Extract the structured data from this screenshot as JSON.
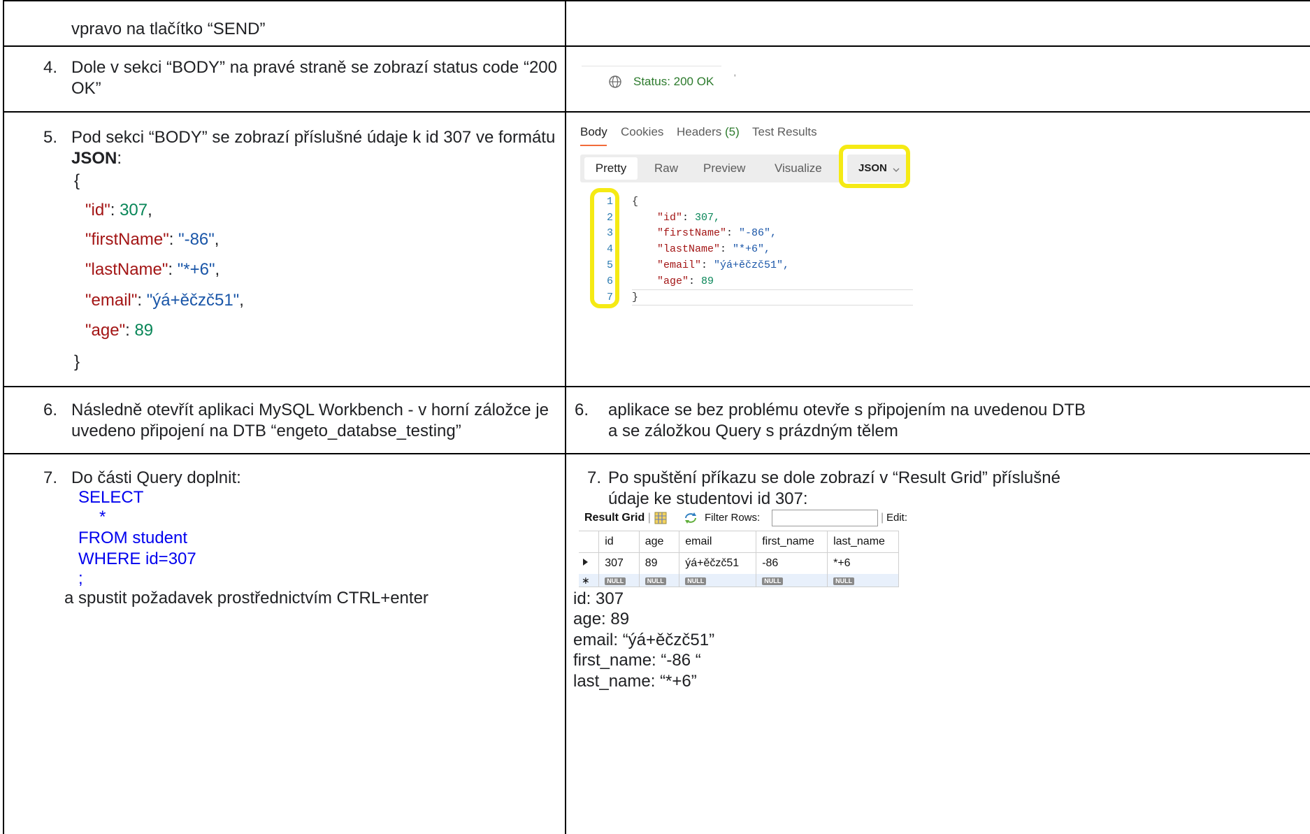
{
  "rows": {
    "r3": {
      "left_text": "vpravo na tlačítko “SEND”"
    },
    "r4": {
      "number": "4.",
      "left_line1": "Dole v sekci “BODY” na pravé straně se zobrazí status code “200",
      "left_line2": "OK”",
      "status_text": "Status: 200 OK",
      "tick": "'"
    },
    "r5": {
      "number": "5.",
      "left_line1": "Pod sekci “BODY” se zobrazí příslušné údaje k id 307 ve formátu",
      "json_label": "JSON",
      "json_colon": ":",
      "brace_open": "{",
      "brace_close": "}",
      "fields": [
        {
          "key": "\"id\"",
          "sep": ": ",
          "value": "307",
          "comma": ","
        },
        {
          "key": "\"firstName\"",
          "sep": ": ",
          "value": "\"-86\"",
          "comma": ","
        },
        {
          "key": "\"lastName\"",
          "sep": ": ",
          "value": "\"*+6\"",
          "comma": ","
        },
        {
          "key": "\"email\"",
          "sep": ": ",
          "value": "\"ýá+ěčzč51\"",
          "comma": ","
        },
        {
          "key": "\"age\"",
          "sep": ": ",
          "value": "89",
          "comma": ""
        }
      ],
      "postman": {
        "tabs": [
          "Body",
          "Cookies",
          "Headers",
          "(5)",
          "Test Results"
        ],
        "views": [
          "Pretty",
          "Raw",
          "Preview",
          "Visualize"
        ],
        "format": "JSON",
        "code_lines": [
          {
            "n": "1",
            "text": "{"
          },
          {
            "n": "2",
            "k": "\"id\"",
            "v": "307,",
            "vt": "num"
          },
          {
            "n": "3",
            "k": "\"firstName\"",
            "v": "\"-86\",",
            "vt": "str"
          },
          {
            "n": "4",
            "k": "\"lastName\"",
            "v": "\"*+6\",",
            "vt": "str"
          },
          {
            "n": "5",
            "k": "\"email\"",
            "v": "\"ýá+ěčzč51\",",
            "vt": "str"
          },
          {
            "n": "6",
            "k": "\"age\"",
            "v": "89",
            "vt": "num"
          },
          {
            "n": "7",
            "text": "}"
          }
        ]
      }
    },
    "r6": {
      "number_left": "6.",
      "left_line1": "Následně otevřít aplikaci MySQL Workbench - v horní záložce je",
      "left_line2": "uvedeno připojení na DTB “engeto_databse_testing”",
      "number_right": "6.",
      "right_line1": "aplikace se bez problému otevře s   připojením na uvedenou DTB",
      "right_line2": "a se záložkou Query s prázdným tělem"
    },
    "r7": {
      "number_left": "7.",
      "left_line1": "Do části Query doplnit:",
      "sql": [
        "SELECT",
        "*",
        "FROM student",
        "WHERE id=307",
        ";"
      ],
      "left_last": "a spustit požadavek prostřednictvím CTRL+enter",
      "number_right": "7.",
      "right_line1": "Po spuštění příkazu se dole zobrazí v “Result Grid” příslušné",
      "right_line2": "údaje ke studentovi id 307:",
      "grid_toolbar": {
        "result_grid": "Result Grid",
        "filter_rows": "Filter Rows:",
        "edit": "Edit:"
      },
      "grid_headers": [
        "id",
        "age",
        "email",
        "first_name",
        "last_name"
      ],
      "grid_row": [
        "307",
        "89",
        "ýá+ěčzč51",
        "-86",
        "*+6"
      ],
      "null_label": "NULL",
      "summary": [
        "id: 307",
        "age: 89",
        "email: “ýá+ěčzč51”",
        "first_name: “-86 “",
        "last_name: “*+6”"
      ]
    }
  },
  "colors": {
    "json_key": "#a31515",
    "json_number": "#098658",
    "json_string": "#1a56a8",
    "sql_text": "#0000ee",
    "highlight": "#f5ea14",
    "postman_accent": "#f26b3a"
  },
  "icons": {
    "status": "globe-icon",
    "grid": "grid-view-icon",
    "refresh": "refresh-icon",
    "row_pointer": "row-pointer-icon",
    "new_row": "new-row-icon",
    "dropdown": "chevron-down-icon"
  }
}
